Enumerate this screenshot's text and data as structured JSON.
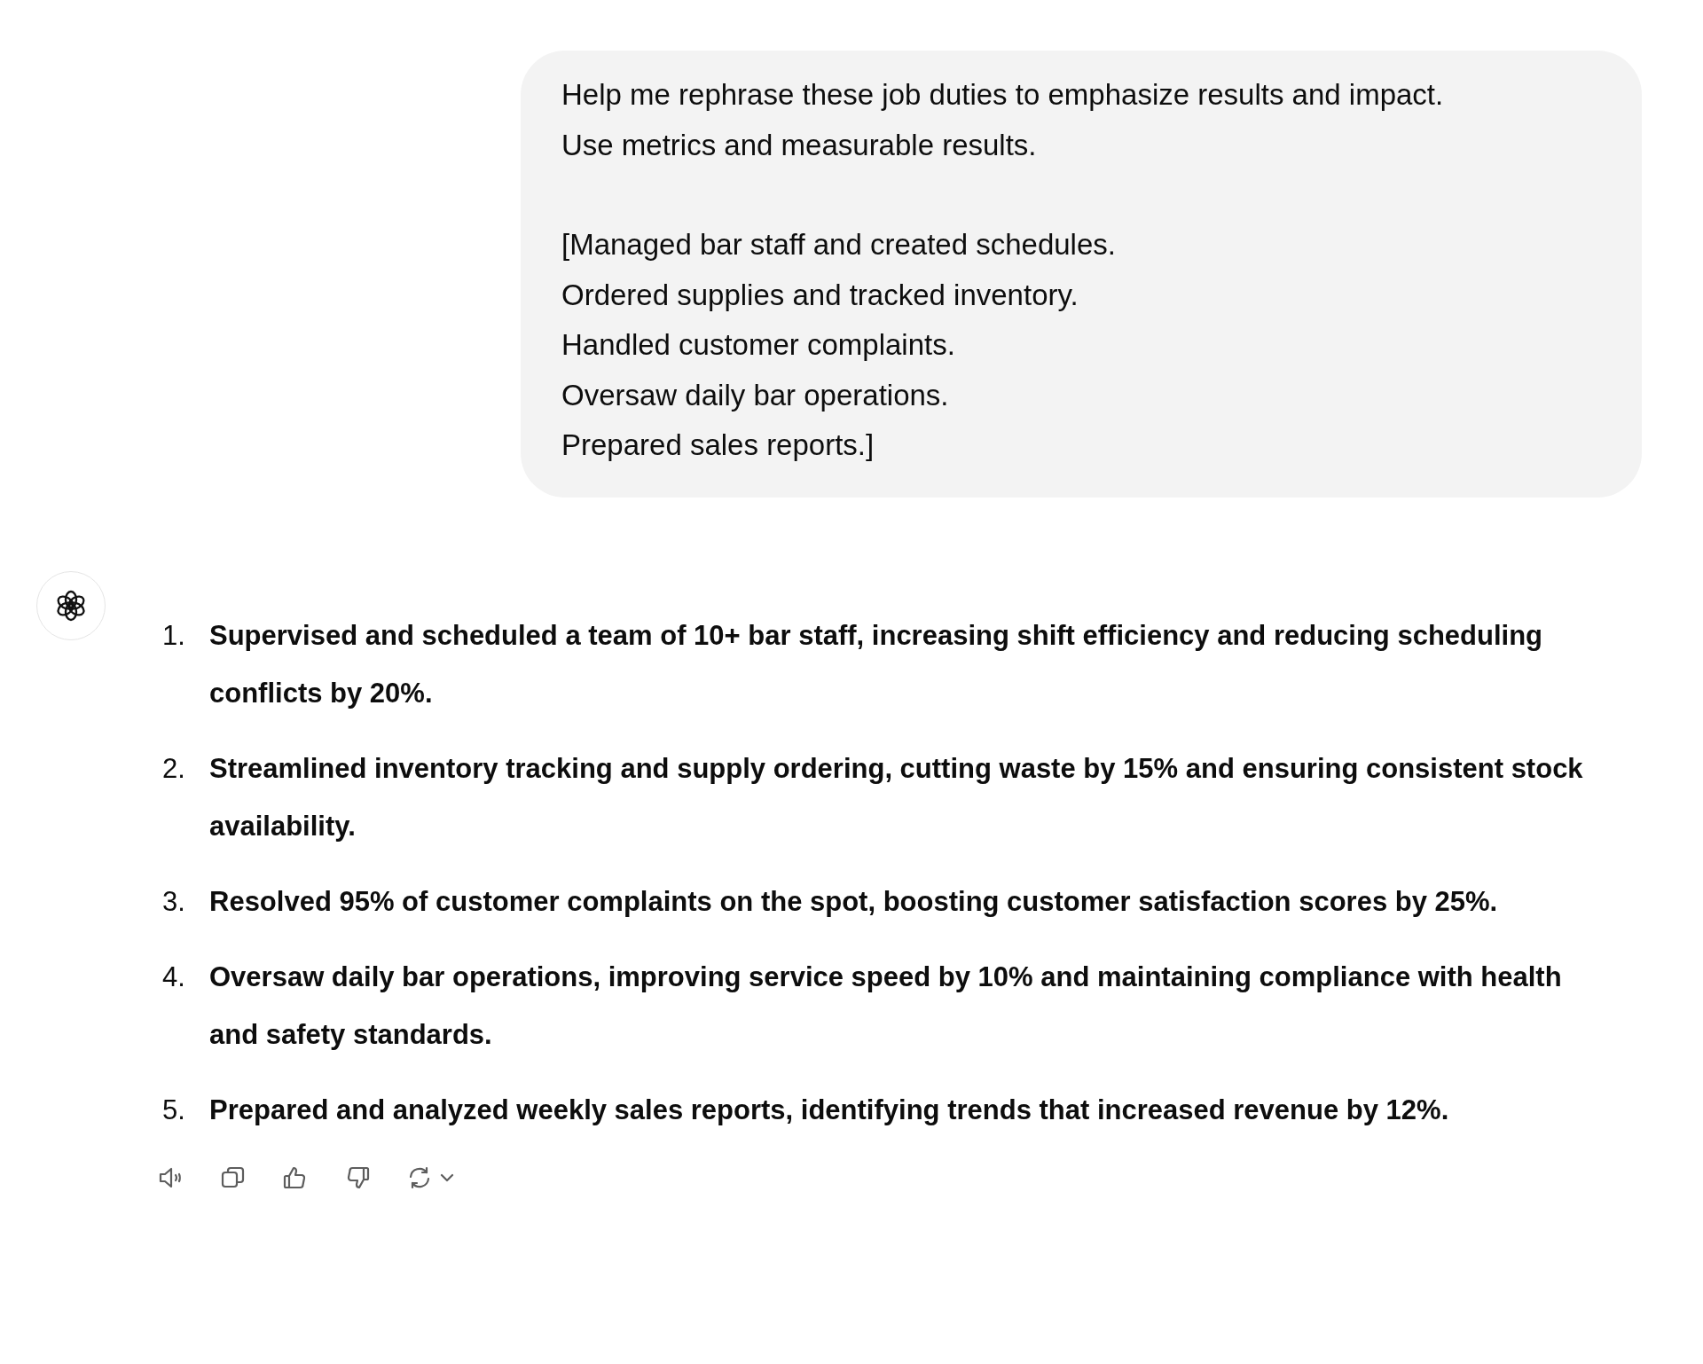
{
  "user_message": {
    "paragraphs": [
      [
        "Help me rephrase these job duties to emphasize results and impact.",
        "Use metrics and measurable results."
      ],
      [
        "[Managed bar staff and created schedules.",
        "Ordered supplies and tracked inventory.",
        "Handled customer complaints.",
        "Oversaw daily bar operations.",
        "Prepared sales reports.]"
      ]
    ]
  },
  "assistant_message": {
    "items": [
      {
        "number": "1.",
        "text": "Supervised and scheduled a team of 10+ bar staff, increasing shift efficiency and reducing scheduling conflicts by 20%."
      },
      {
        "number": "2.",
        "text": "Streamlined inventory tracking and supply ordering, cutting waste by 15% and ensuring consistent stock availability."
      },
      {
        "number": "3.",
        "text": "Resolved 95% of customer complaints on the spot, boosting customer satisfaction scores by 25%."
      },
      {
        "number": "4.",
        "text": "Oversaw daily bar operations, improving service speed by 10% and maintaining compliance with health and safety standards."
      },
      {
        "number": "5.",
        "text": "Prepared and analyzed weekly sales reports, identifying trends that increased revenue by 12%."
      }
    ]
  },
  "actions": [
    {
      "kind": "read_aloud"
    },
    {
      "kind": "copy"
    },
    {
      "kind": "like"
    },
    {
      "kind": "dislike"
    },
    {
      "kind": "regenerate"
    }
  ]
}
